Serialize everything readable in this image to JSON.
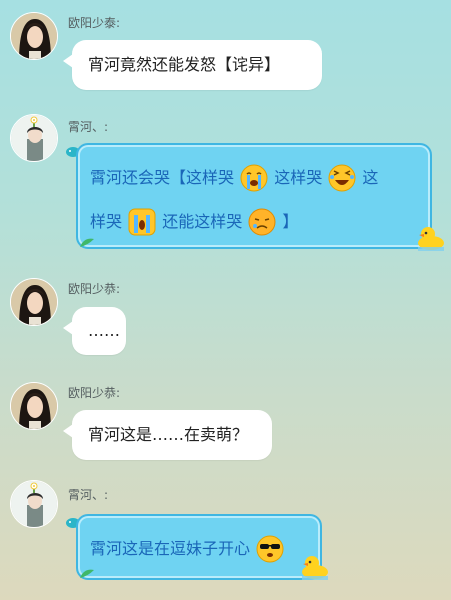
{
  "messages": [
    {
      "sender": "欧阳少泰:",
      "avatar": "long-hair-avatar",
      "style": "white",
      "text": "宵河竟然还能发怒【诧异】"
    },
    {
      "sender": "霄河、:",
      "avatar": "flower-hat-avatar",
      "style": "blue",
      "lines": [
        [
          "霄河还会哭【这样哭",
          "这样哭",
          "这"
        ],
        [
          "样哭",
          "还能这样哭",
          "】"
        ]
      ],
      "emojis": [
        "crying-face-emoji",
        "laughing-tears-emoji",
        "wailing-face-emoji",
        "sobbing-face-emoji"
      ]
    },
    {
      "sender": "欧阳少恭:",
      "avatar": "long-hair-avatar",
      "style": "white",
      "text": "……"
    },
    {
      "sender": "欧阳少恭:",
      "avatar": "long-hair-avatar",
      "style": "white",
      "text": "宵河这是……在卖萌？"
    },
    {
      "sender": "霄河、:",
      "avatar": "flower-hat-avatar",
      "style": "blue",
      "text": "霄河这是在逗妹子开心",
      "emojis": [
        "cool-sunglasses-emoji"
      ]
    }
  ],
  "colors": {
    "bubble_blue": "#6fd3f2",
    "bubble_blue_border": "#3fb6e2",
    "bubble_blue_text": "#1a66b8",
    "bubble_white": "#ffffff"
  }
}
